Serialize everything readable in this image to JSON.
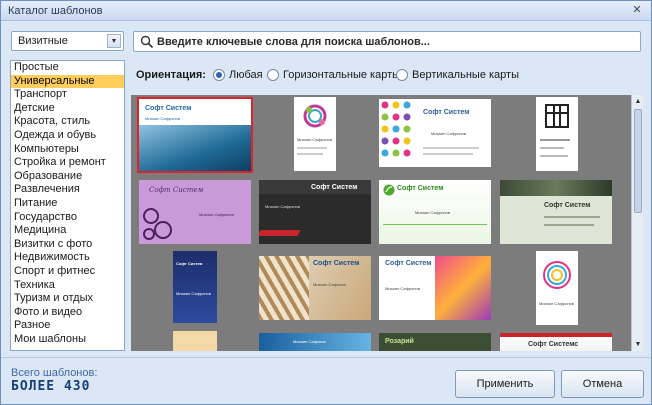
{
  "window": {
    "title": "Каталог шаблонов",
    "close_label": "✕"
  },
  "category_select": {
    "value": "Визитные"
  },
  "categories": [
    "Простые",
    "Универсальные",
    "Транспорт",
    "Детские",
    "Красота, стиль",
    "Одежда и обувь",
    "Компьютеры",
    "Стройка и ремонт",
    "Образование",
    "Развлечения",
    "Питание",
    "Государство",
    "Медицина",
    "Визитки с фото",
    "Недвижимость",
    "Спорт и фитнес",
    "Техника",
    "Туризм и отдых",
    "Фото и видео",
    "Разное",
    "Мои шаблоны"
  ],
  "selected_category_index": 1,
  "search": {
    "placeholder": "Введите ключевые слова для поиска шаблонов..."
  },
  "orientation": {
    "label": "Ориентация:",
    "options": [
      "Любая",
      "Горизонтальные карты",
      "Вертикальные карты"
    ],
    "selected": "Любая"
  },
  "templates": {
    "company": "Софт Систем",
    "company_alt": "Софт Системс",
    "person": "Михаил Сафронов",
    "person_alt": "Михаил Сафонов",
    "rozariy": "Розарий"
  },
  "colors": {
    "selection": "#ffcd5a",
    "accent": "#2b61b5",
    "highlight": "#e0232b"
  },
  "footer": {
    "total_label": "Всего шаблонов:",
    "total_value": "БОЛЕЕ 430",
    "apply_label": "Применить",
    "cancel_label": "Отмена"
  }
}
